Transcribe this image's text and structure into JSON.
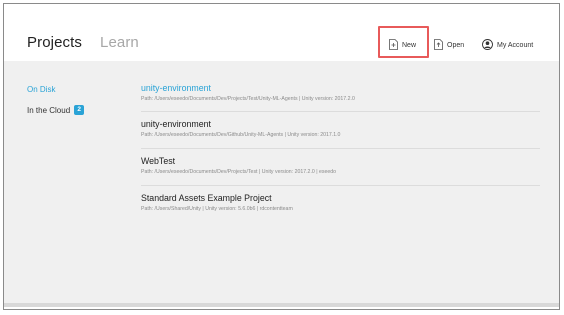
{
  "nav": {
    "projects_label": "Projects",
    "learn_label": "Learn"
  },
  "toolbar": {
    "new_label": "New",
    "open_label": "Open",
    "account_label": "My Account"
  },
  "sidebar": {
    "items": [
      {
        "label": "On Disk"
      },
      {
        "label": "In the Cloud",
        "badge": "2"
      }
    ]
  },
  "projects": [
    {
      "name": "unity-environment",
      "path": "Path: /Users/eseedo/Documents/Dev/Projects/Test/Unity-ML-Agents | Unity version: 2017.2.0"
    },
    {
      "name": "unity-environment",
      "path": "Path: /Users/eseedo/Documents/Dev/Github/Unity-ML-Agents | Unity version: 2017.1.0"
    },
    {
      "name": "WebTest",
      "path": "Path: /Users/eseedo/Documents/Dev/Projects/Test | Unity version: 2017.2.0 | eseedo"
    },
    {
      "name": "Standard Assets Example Project",
      "path": "Path: /Users/Shared/Unity | Unity version: 5.6.0b6 | rdcontentteam"
    }
  ],
  "colors": {
    "accent": "#2aa3d6",
    "highlight": "#e85a5a"
  },
  "icons": {
    "new": "new-file-icon",
    "open": "open-file-icon",
    "account": "account-icon"
  }
}
